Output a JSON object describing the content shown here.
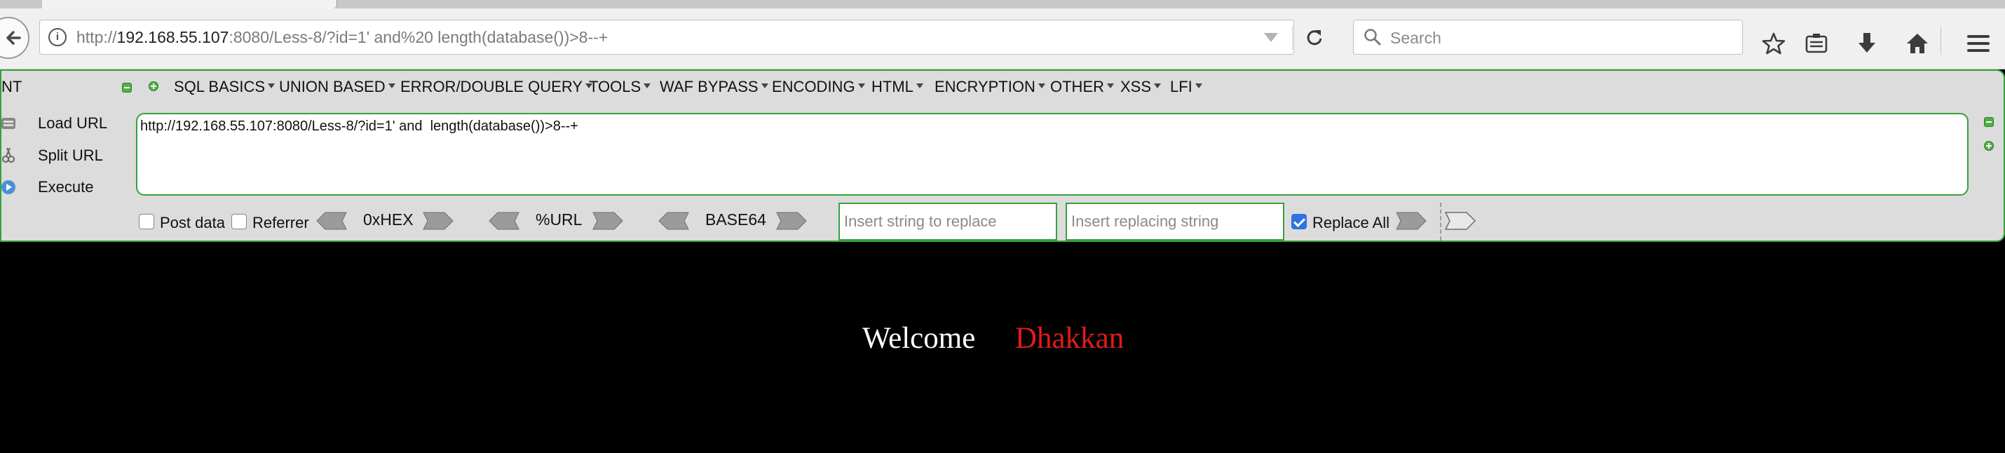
{
  "browser": {
    "url": {
      "scheme": "http://",
      "host": "192.168.55.107",
      "rest": ":8080/Less-8/?id=1' and%20 length(database())>8--+"
    },
    "search_placeholder": "Search",
    "icons": [
      "back-arrow-icon",
      "info-icon",
      "dropdown-icon",
      "reload-icon",
      "search-icon",
      "bookmark-star-icon",
      "reading-list-icon",
      "download-icon",
      "home-icon",
      "hamburger-menu-icon"
    ]
  },
  "hackbar": {
    "left_fragment": "NT",
    "menu": [
      "SQL BASICS",
      "UNION BASED",
      "ERROR/DOUBLE QUERY",
      "TOOLS",
      "WAF BYPASS",
      "ENCODING",
      "HTML",
      "ENCRYPTION",
      "OTHER",
      "XSS",
      "LFI"
    ],
    "load_url": "Load URL",
    "split_url": "Split URL",
    "execute": "Execute",
    "url_value": "http://192.168.55.107:8080/Less-8/?id=1' and  length(database())>8--+",
    "post_data": "Post data",
    "post_data_checked": false,
    "referrer": "Referrer",
    "referrer_checked": false,
    "hex": "0xHEX",
    "urlenc": "%URL",
    "base64": "BASE64",
    "replace_placeholder": "Insert string to replace",
    "replacing_placeholder": "Insert replacing string",
    "replace_all": "Replace All",
    "replace_all_checked": true,
    "accent_color": "#35a23b"
  },
  "page": {
    "welcome": "Welcome",
    "username": "Dhakkan",
    "username_color": "#e01b1b",
    "background": "#000000"
  }
}
